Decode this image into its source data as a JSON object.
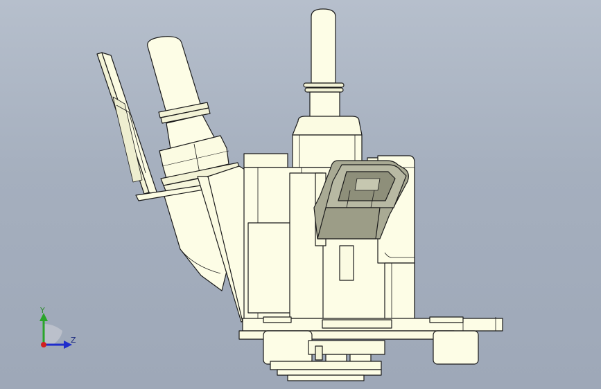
{
  "viewport": {
    "background_top": "#b6bfcc",
    "background_bottom": "#9ea8b8",
    "part_color": "#fdfde6",
    "shade_color": "#e6e6c8",
    "connector_color": "#a9aa94",
    "edge_color": "#1a1a1a"
  },
  "triad": {
    "y_label": "Y",
    "z_label": "Z",
    "y_color": "#2aa52a",
    "z_color": "#1f2dcc",
    "x_color": "#d22020"
  }
}
